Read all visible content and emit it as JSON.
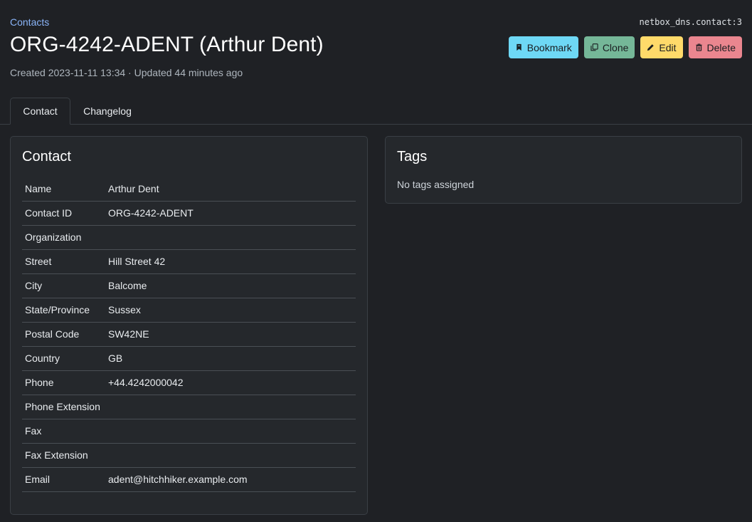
{
  "breadcrumb": {
    "label": "Contacts"
  },
  "object_id": "netbox_dns.contact:3",
  "title": "ORG-4242-ADENT (Arthur Dent)",
  "meta": "Created 2023-11-11 13:34 · Updated 44 minutes ago",
  "actions": {
    "bookmark": {
      "label": "Bookmark",
      "icon": "bookmark-icon",
      "color": "#6ed8f5"
    },
    "clone": {
      "label": "Clone",
      "icon": "copy-icon",
      "color": "#75b798"
    },
    "edit": {
      "label": "Edit",
      "icon": "pencil-icon",
      "color": "#ffda6a"
    },
    "delete": {
      "label": "Delete",
      "icon": "trash-icon",
      "color": "#ea868f"
    }
  },
  "tabs": [
    {
      "label": "Contact",
      "active": true
    },
    {
      "label": "Changelog",
      "active": false
    }
  ],
  "contact_card": {
    "title": "Contact",
    "rows": [
      {
        "label": "Name",
        "value": "Arthur Dent"
      },
      {
        "label": "Contact ID",
        "value": "ORG-4242-ADENT"
      },
      {
        "label": "Organization",
        "value": ""
      },
      {
        "label": "Street",
        "value": "Hill Street 42"
      },
      {
        "label": "City",
        "value": "Balcome"
      },
      {
        "label": "State/Province",
        "value": "Sussex"
      },
      {
        "label": "Postal Code",
        "value": "SW42NE"
      },
      {
        "label": "Country",
        "value": "GB"
      },
      {
        "label": "Phone",
        "value": "+44.4242000042"
      },
      {
        "label": "Phone Extension",
        "value": ""
      },
      {
        "label": "Fax",
        "value": ""
      },
      {
        "label": "Fax Extension",
        "value": ""
      },
      {
        "label": "Email",
        "value": "adent@hitchhiker.example.com"
      }
    ]
  },
  "tags_card": {
    "title": "Tags",
    "empty_text": "No tags assigned"
  }
}
